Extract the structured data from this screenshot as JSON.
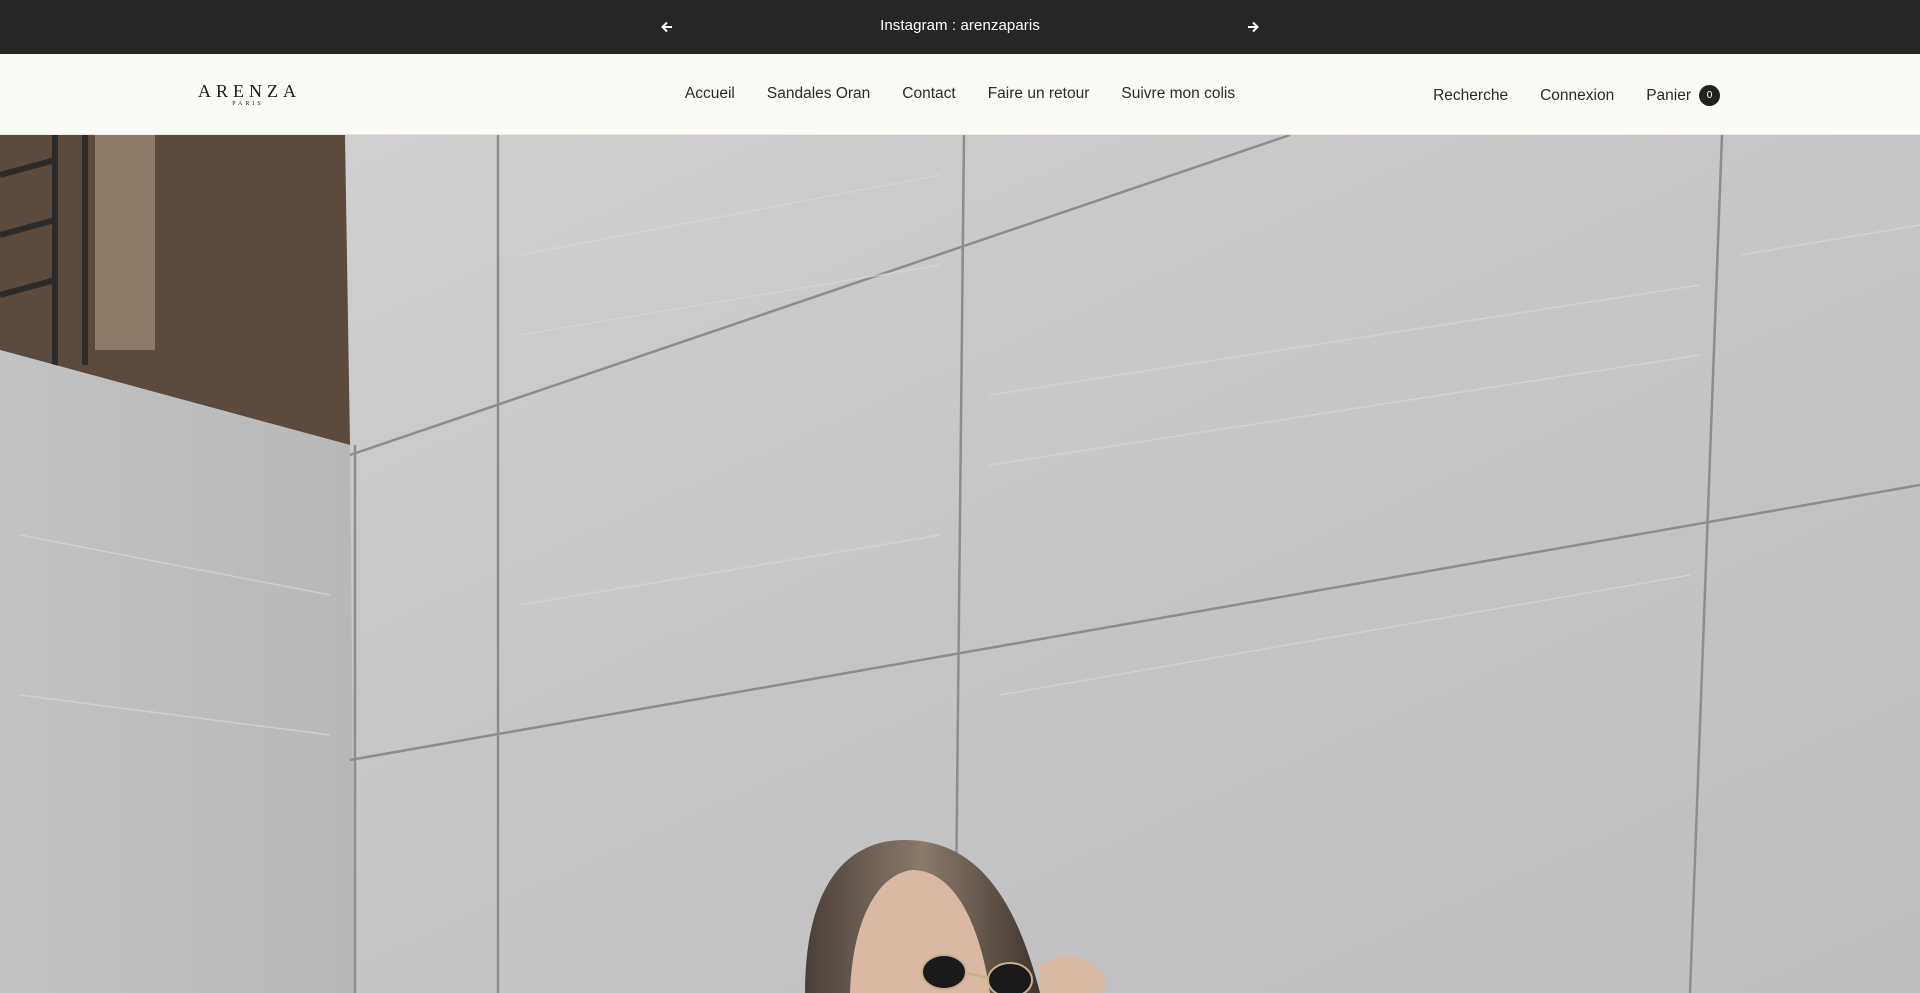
{
  "announcement": {
    "text": "Instagram : arenzaparis",
    "prev_icon": "arrow-left-icon",
    "next_icon": "arrow-right-icon"
  },
  "header": {
    "logo": {
      "main": "ARENZA",
      "sub": "PARIS"
    },
    "nav": [
      "Accueil",
      "Sandales Oran",
      "Contact",
      "Faire un retour",
      "Suivre mon colis"
    ],
    "search_label": "Recherche",
    "login_label": "Connexion",
    "cart_label": "Panier",
    "cart_count": "0"
  },
  "hero": {
    "image": "hero-image: woman with sunglasses against grey marble tiled wall"
  },
  "colors": {
    "announcement_bg": "#262626",
    "header_bg": "#fbfaf6",
    "wall": "#c9c8c9"
  }
}
